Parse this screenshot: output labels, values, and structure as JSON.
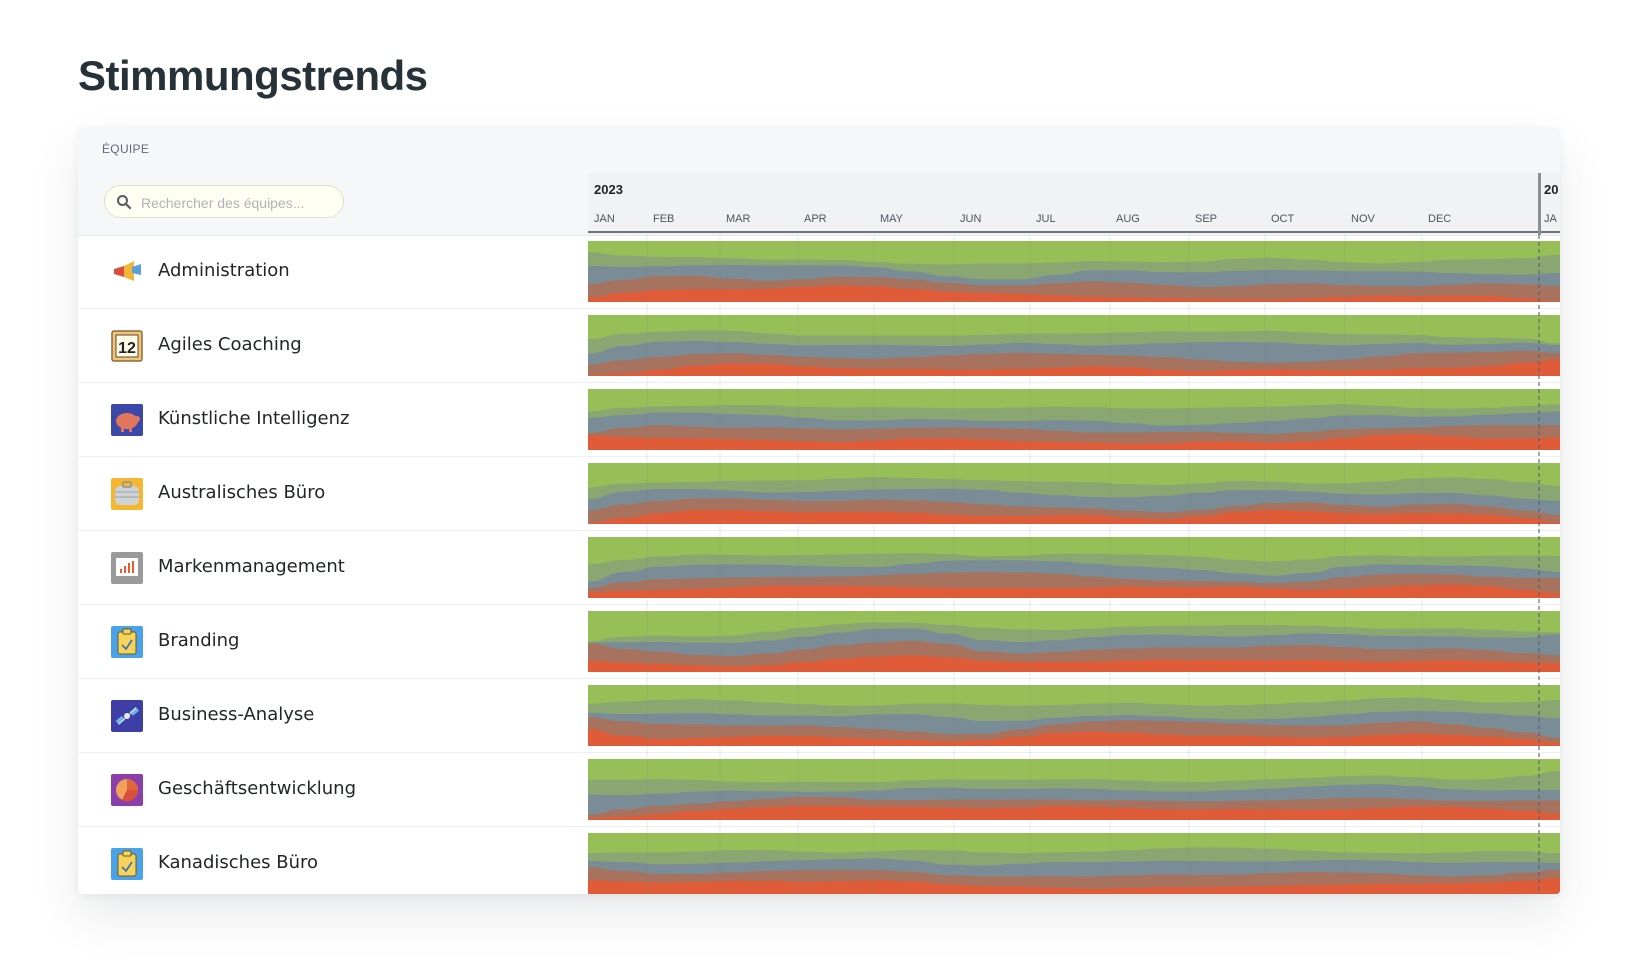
{
  "page": {
    "title": "Stimmungstrends"
  },
  "table": {
    "column_label": "ÉQUIPE",
    "search": {
      "placeholder": "Rechercher des équipes...",
      "value": ""
    }
  },
  "timeline": {
    "year": "2023",
    "next_year_partial": "20",
    "months": [
      "JAN",
      "FEB",
      "MAR",
      "APR",
      "MAY",
      "JUN",
      "JUL",
      "AUG",
      "SEP",
      "OCT",
      "NOV",
      "DEC",
      "JA"
    ]
  },
  "colors": {
    "very_positive": "#97bf57",
    "positive": "#8aa772",
    "neutral": "#7a8c96",
    "negative": "#a7735f",
    "very_negative": "#e05c38"
  },
  "teams": [
    {
      "name": "Administration",
      "icon": "megaphone-icon",
      "seed": 3
    },
    {
      "name": "Agiles Coaching",
      "icon": "calendar-icon",
      "seed": 7
    },
    {
      "name": "Künstliche Intelligenz",
      "icon": "piggy-bank-icon",
      "seed": 11
    },
    {
      "name": "Australisches Büro",
      "icon": "briefcase-icon",
      "seed": 17
    },
    {
      "name": "Markenmanagement",
      "icon": "presentation-chart-icon",
      "seed": 23
    },
    {
      "name": "Branding",
      "icon": "clipboard-icon",
      "seed": 29
    },
    {
      "name": "Business-Analyse",
      "icon": "satellite-icon",
      "seed": 31
    },
    {
      "name": "Geschäftsentwicklung",
      "icon": "pie-chart-icon",
      "seed": 37
    },
    {
      "name": "Kanadisches Büro",
      "icon": "clipboard-icon",
      "seed": 41
    }
  ]
}
